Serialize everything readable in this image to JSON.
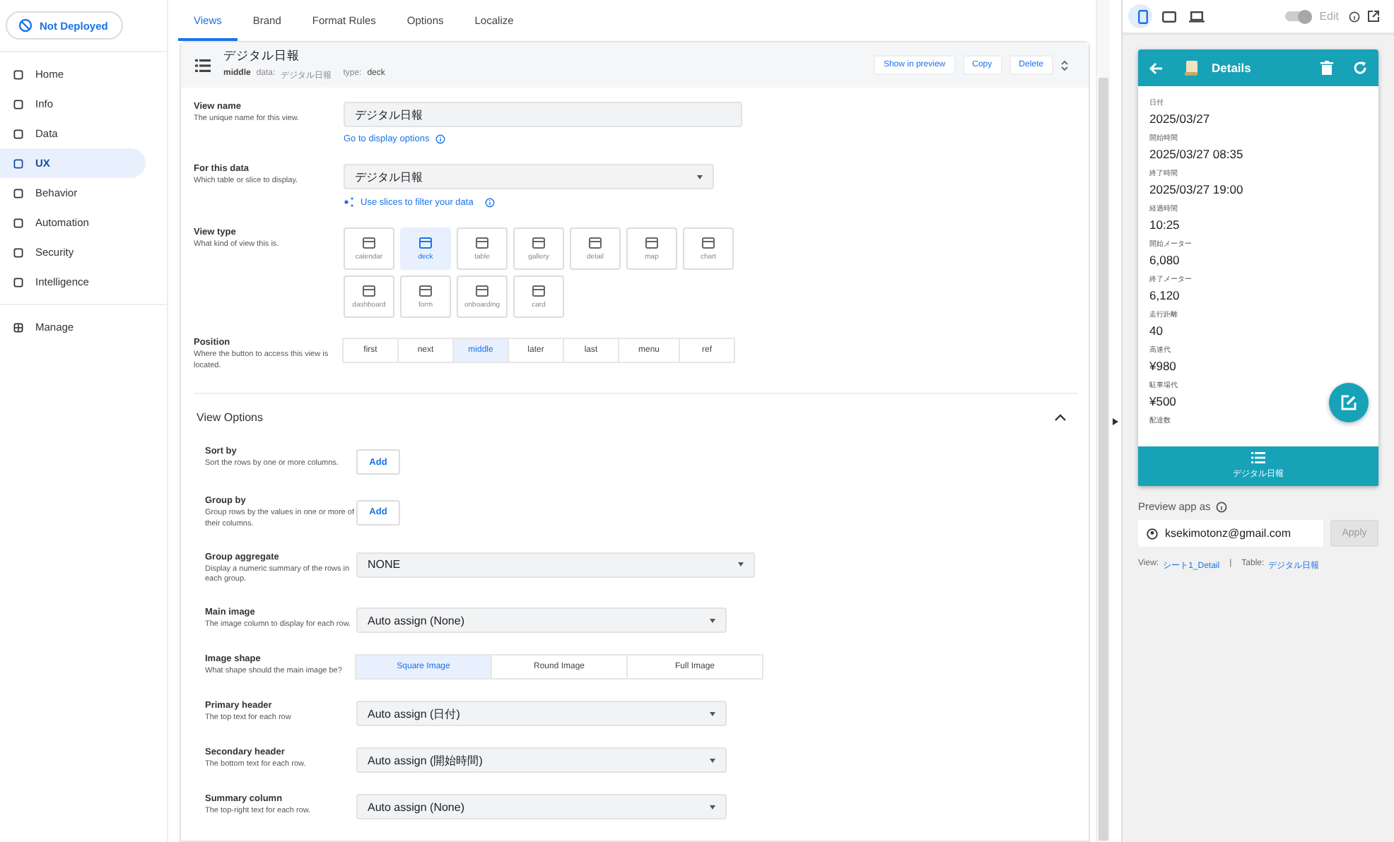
{
  "deploy_status": "Not Deployed",
  "sidebar": {
    "items": [
      {
        "label": "Home",
        "selected": false
      },
      {
        "label": "Info",
        "selected": false
      },
      {
        "label": "Data",
        "selected": false
      },
      {
        "label": "UX",
        "selected": true
      },
      {
        "label": "Behavior",
        "selected": false
      },
      {
        "label": "Automation",
        "selected": false
      },
      {
        "label": "Security",
        "selected": false
      },
      {
        "label": "Intelligence",
        "selected": false
      }
    ],
    "bottom_items": [
      {
        "label": "Manage",
        "selected": false
      }
    ]
  },
  "tabs": [
    {
      "label": "Views",
      "selected": true
    },
    {
      "label": "Brand",
      "selected": false
    },
    {
      "label": "Format Rules",
      "selected": false
    },
    {
      "label": "Options",
      "selected": false
    },
    {
      "label": "Localize",
      "selected": false
    }
  ],
  "view_header": {
    "title": "デジタル日報",
    "position": "middle",
    "data_label": "data:",
    "data_value": "デジタル日報",
    "type_label": "type:",
    "type_value": "deck",
    "buttons": [
      "Show in preview",
      "Copy",
      "Delete"
    ]
  },
  "view_name": {
    "label": "View name",
    "hint": "The unique name for this view.",
    "value": "デジタル日報",
    "link": "Go to display options"
  },
  "for_this_data": {
    "label": "For this data",
    "hint": "Which table or slice to display.",
    "value": "デジタル日報",
    "link": "Use slices to filter your data"
  },
  "view_type": {
    "label": "View type",
    "hint": "What kind of view this is.",
    "options": [
      {
        "label": "calendar",
        "selected": false
      },
      {
        "label": "deck",
        "selected": true
      },
      {
        "label": "table",
        "selected": false
      },
      {
        "label": "gallery",
        "selected": false
      },
      {
        "label": "detail",
        "selected": false
      },
      {
        "label": "map",
        "selected": false
      },
      {
        "label": "chart",
        "selected": false
      },
      {
        "label": "dashboard",
        "selected": false
      },
      {
        "label": "form",
        "selected": false
      },
      {
        "label": "onboarding",
        "selected": false
      },
      {
        "label": "card",
        "selected": false
      }
    ]
  },
  "position": {
    "label": "Position",
    "hint": "Where the button to access this view is located.",
    "options": [
      {
        "label": "first",
        "selected": false
      },
      {
        "label": "next",
        "selected": false
      },
      {
        "label": "middle",
        "selected": true
      },
      {
        "label": "later",
        "selected": false
      },
      {
        "label": "last",
        "selected": false
      },
      {
        "label": "menu",
        "selected": false
      },
      {
        "label": "ref",
        "selected": false
      }
    ]
  },
  "view_options": {
    "title": "View Options",
    "expanded": true,
    "rows": [
      {
        "kind": "add",
        "label": "Sort by",
        "hint": "Sort the rows by one or more columns.",
        "button": "Add"
      },
      {
        "kind": "add",
        "label": "Group by",
        "hint": "Group rows by the values in one or more of their columns.",
        "button": "Add"
      },
      {
        "kind": "select",
        "label": "Group aggregate",
        "hint": "Display a numeric summary of the rows in each group.",
        "value": "NONE",
        "wide": true
      },
      {
        "kind": "select",
        "label": "Main image",
        "hint": "The image column to display for each row.",
        "value": "Auto assign (None)",
        "wide": false
      },
      {
        "kind": "segments",
        "label": "Image shape",
        "hint": "What shape should the main image be?",
        "options": [
          {
            "label": "Square Image",
            "selected": true
          },
          {
            "label": "Round Image",
            "selected": false
          },
          {
            "label": "Full Image",
            "selected": false
          }
        ]
      },
      {
        "kind": "select",
        "label": "Primary header",
        "hint": "The top text for each row",
        "value": "Auto assign (日付)",
        "wide": false
      },
      {
        "kind": "select",
        "label": "Secondary header",
        "hint": "The bottom text for each row.",
        "value": "Auto assign (開始時間)",
        "wide": false
      },
      {
        "kind": "select",
        "label": "Summary column",
        "hint": "The top-right text for each row.",
        "value": "Auto assign (None)",
        "wide": false
      }
    ]
  },
  "preview": {
    "devices": [
      {
        "selected": true
      },
      {
        "selected": false
      },
      {
        "selected": false
      }
    ],
    "edit_toggle": {
      "label": "Edit",
      "on": true
    },
    "app": {
      "title": "Details",
      "fields": [
        {
          "label": "日付",
          "value": "2025/03/27"
        },
        {
          "label": "開始時間",
          "value": "2025/03/27 08:35"
        },
        {
          "label": "終了時間",
          "value": "2025/03/27 19:00"
        },
        {
          "label": "経過時間",
          "value": "10:25"
        },
        {
          "label": "開始メーター",
          "value": "6,080"
        },
        {
          "label": "終了メーター",
          "value": "6,120"
        },
        {
          "label": "走行距離",
          "value": "40"
        },
        {
          "label": "高速代",
          "value": "¥980"
        },
        {
          "label": "駐車場代",
          "value": "¥500"
        },
        {
          "label": "配達数"
        }
      ],
      "nav_label": "デジタル日報"
    },
    "preview_as": {
      "label": "Preview app as",
      "value": "ksekimotonz@gmail.com",
      "button": "Apply"
    },
    "footer": {
      "view_label": "View:",
      "view_value": "シート1_Detail",
      "separator": "|",
      "table_label": "Table:",
      "table_value": "デジタル日報"
    }
  }
}
